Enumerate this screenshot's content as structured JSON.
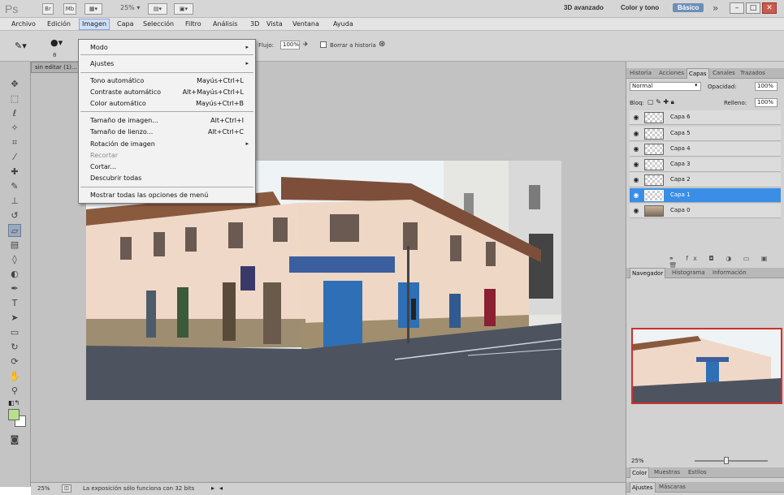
{
  "titlebar": {
    "logo": "Ps",
    "zoom_value": "25% ▾",
    "workspaces": [
      "3D avanzado",
      "Color y tono",
      "Básico"
    ],
    "active_workspace": "Básico",
    "more": "»"
  },
  "menubar": {
    "items": [
      "Archivo",
      "Edición",
      "Imagen",
      "Capa",
      "Selección",
      "Filtro",
      "Análisis",
      "3D",
      "Vista",
      "Ventana",
      "Ayuda"
    ],
    "open_item": "Imagen"
  },
  "optbar": {
    "brush_size": "8",
    "flujo_label": "Flujo:",
    "flujo_value": "100%",
    "borrar_historia": "Borrar a historia"
  },
  "document": {
    "tab_title": "sin editar (1)..."
  },
  "dropdown": {
    "items": [
      {
        "label": "Modo",
        "shortcut": "",
        "submenu": true,
        "disabled": false
      },
      {
        "label": "Ajustes",
        "shortcut": "",
        "submenu": true,
        "disabled": false
      },
      {
        "label": "Tono automático",
        "shortcut": "Mayús+Ctrl+L",
        "submenu": false,
        "disabled": false
      },
      {
        "label": "Contraste automático",
        "shortcut": "Alt+Mayús+Ctrl+L",
        "submenu": false,
        "disabled": false
      },
      {
        "label": "Color automático",
        "shortcut": "Mayús+Ctrl+B",
        "submenu": false,
        "disabled": false
      },
      {
        "label": "Tamaño de imagen...",
        "shortcut": "Alt+Ctrl+I",
        "submenu": false,
        "disabled": false
      },
      {
        "label": "Tamaño de lienzo...",
        "shortcut": "Alt+Ctrl+C",
        "submenu": false,
        "disabled": false
      },
      {
        "label": "Rotación de imagen",
        "shortcut": "",
        "submenu": true,
        "disabled": false
      },
      {
        "label": "Recortar",
        "shortcut": "",
        "submenu": false,
        "disabled": true
      },
      {
        "label": "Cortar...",
        "shortcut": "",
        "submenu": false,
        "disabled": false
      },
      {
        "label": "Descubrir todas",
        "shortcut": "",
        "submenu": false,
        "disabled": false
      },
      {
        "label": "Mostrar todas las opciones de menú",
        "shortcut": "",
        "submenu": false,
        "disabled": false
      }
    ]
  },
  "layers_panel": {
    "tabs": [
      "Historia",
      "Acciones",
      "Capas",
      "Canales",
      "Trazados"
    ],
    "active_tab": "Capas",
    "blend_mode": "Normal",
    "opacity_label": "Opacidad:",
    "opacity_value": "100%",
    "lock_label": "Bloq:",
    "fill_label": "Relleno:",
    "fill_value": "100%",
    "layers": [
      {
        "name": "Capa 6",
        "selected": false,
        "photo": false
      },
      {
        "name": "Capa 5",
        "selected": false,
        "photo": false
      },
      {
        "name": "Capa 4",
        "selected": false,
        "photo": false
      },
      {
        "name": "Capa 3",
        "selected": false,
        "photo": false
      },
      {
        "name": "Capa 2",
        "selected": false,
        "photo": false
      },
      {
        "name": "Capa 1",
        "selected": true,
        "photo": false
      },
      {
        "name": "Capa 0",
        "selected": false,
        "photo": true
      }
    ]
  },
  "navigator_panel": {
    "tabs": [
      "Navegador",
      "Histograma",
      "Información"
    ],
    "active_tab": "Navegador",
    "zoom": "25%"
  },
  "color_panel": {
    "tabs": [
      "Color",
      "Muestras",
      "Estilos"
    ],
    "active_tab": "Color"
  },
  "adjust_panel": {
    "tabs": [
      "Ajustes",
      "Máscaras"
    ],
    "active_tab": "Ajustes"
  },
  "statusbar": {
    "zoom": "25%",
    "message": "La exposición sólo funciona con 32 bits"
  },
  "colors": {
    "foreground": "#b8e08a",
    "background": "#ffffff",
    "selection": "#3a8ee6"
  }
}
